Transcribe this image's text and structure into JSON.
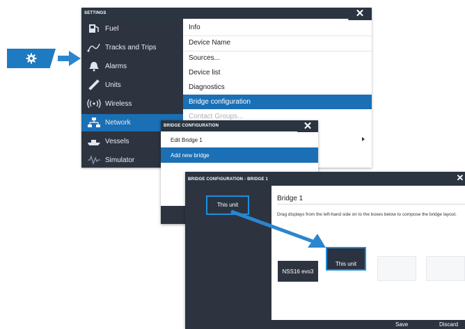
{
  "settings": {
    "title": "SETTINGS",
    "close_glyph": "✕",
    "sidebar": [
      {
        "label": "Fuel",
        "icon": "fuel-icon"
      },
      {
        "label": "Tracks and Trips",
        "icon": "tracks-icon"
      },
      {
        "label": "Alarms",
        "icon": "alarm-bell-icon"
      },
      {
        "label": "Units",
        "icon": "ruler-icon"
      },
      {
        "label": "Wireless",
        "icon": "wireless-icon"
      },
      {
        "label": "Network",
        "icon": "network-icon",
        "active": true
      },
      {
        "label": "Vessels",
        "icon": "vessels-icon"
      },
      {
        "label": "Simulator",
        "icon": "simulator-icon"
      }
    ],
    "menu": [
      {
        "label": "Info"
      },
      {
        "label": "Device Name"
      },
      {
        "label": "Sources..."
      },
      {
        "label": "Device list"
      },
      {
        "label": "Diagnostics"
      },
      {
        "label": "Bridge configuration",
        "selected": true
      },
      {
        "label": "Contact Groups...",
        "faded": true
      }
    ]
  },
  "bridge_dialog": {
    "title": "BRIDGE CONFIGURATION",
    "close_glyph": "✕",
    "items": [
      {
        "label": "Edit Bridge 1"
      },
      {
        "label": "Add new bridge",
        "selected": true
      }
    ]
  },
  "bridge1_dialog": {
    "title": "BRIDGE CONFIGURATION - BRIDGE 1",
    "close_glyph": "✕",
    "heading": "Bridge 1",
    "instruction": "Drag displays from the left-hand side on to the boxes below to compose the bridge layout.",
    "source_unit": "This unit",
    "slots": [
      {
        "label": "NSS16 evo3"
      },
      {
        "label": "This unit"
      }
    ],
    "footer": {
      "save": "Save",
      "discard": "Discard"
    }
  },
  "colors": {
    "accent_blue": "#1a6fb5",
    "dark_panel": "#2d3440",
    "titlebar": "#2b3441"
  }
}
